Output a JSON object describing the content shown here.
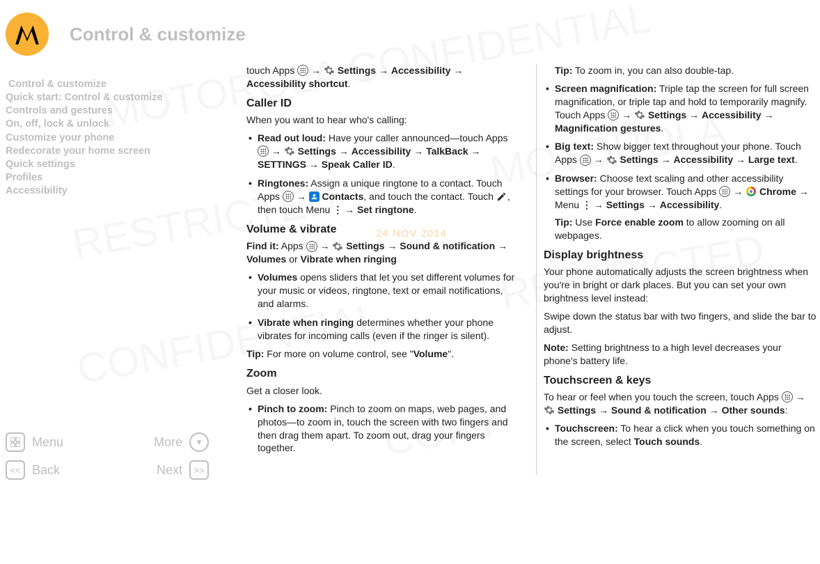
{
  "header": {
    "title": "Control & customize"
  },
  "watermark_date": "24 NOV 2014",
  "sidebar": {
    "items": [
      "Control & customize",
      "Quick start: Control & customize",
      "Controls and gestures",
      "On, off, lock & unlock",
      "Customize your phone",
      "Redecorate your home screen",
      "Quick settings",
      "Profiles",
      "Accessibility"
    ]
  },
  "bottomnav": {
    "menu": "Menu",
    "more": "More",
    "back": "Back",
    "next": "Next"
  },
  "col1": {
    "p1a": "touch Apps ",
    "p1b": " Settings",
    "p1c": "Accessibility",
    "p1d": "Accessibility shortcut",
    "h_callerid": "Caller ID",
    "callerid_lead": "When you want to hear who's calling:",
    "read_label": "Read out loud:",
    "read_text": " Have your caller announced—touch Apps ",
    "read_settings": " Settings",
    "read_acc": "Accessibility",
    "read_tb": "TalkBack",
    "read_set": "SETTINGS",
    "read_speak": "Speak Caller ID",
    "ring_label": "Ringtones:",
    "ring_text1": " Assign a unique ringtone to a contact. Touch Apps ",
    "ring_contacts": " Contacts",
    "ring_text2": ", and touch the contact. Touch ",
    "ring_text3": ", then touch Menu ",
    "ring_set": "Set ringtone",
    "h_volume": "Volume & vibrate",
    "findit": "Find it:",
    "vol_path1": " Apps ",
    "vol_settings": " Settings",
    "vol_sound": "Sound & notification",
    "vol_volumes": "Volumes",
    "vol_or": " or ",
    "vol_vibrate": "Vibrate when ringing",
    "vol_li1a": "Volumes",
    "vol_li1b": " opens sliders that let you set different volumes for your music or videos, ringtone, text or email notifications, and alarms.",
    "vol_li2a": "Vibrate when ringing",
    "vol_li2b": " determines whether your phone vibrates for incoming calls (even if the ringer is silent).",
    "vol_tip_label": "Tip:",
    "vol_tip": " For more on volume control, see \"",
    "vol_tip_link": "Volume",
    "vol_tip_end": "\".",
    "h_zoom": "Zoom",
    "zoom_lead": "Get a closer look.",
    "pinch_label": "Pinch to zoom:",
    "pinch_text": " Pinch to zoom on maps, web pages, and photos—to zoom in, touch the screen with two fingers and then drag them apart. To zoom out, drag your fingers together."
  },
  "col2": {
    "tip1_label": "Tip:",
    "tip1": " To zoom in, you can also double-tap.",
    "mag_label": "Screen magnification:",
    "mag_text": " Triple tap the screen for full screen magnification, or triple tap and hold to temporarily magnify. Touch Apps ",
    "mag_settings": " Settings",
    "mag_acc": "Accessibility",
    "mag_gest": "Magnification gestures",
    "big_label": "Big text:",
    "big_text": " Show bigger text throughout your phone. Touch Apps ",
    "big_settings": " Settings",
    "big_acc": "Accessibility",
    "big_large": "Large text",
    "browser_label": "Browser:",
    "browser_text": " Choose text scaling and other accessibility settings for your browser. Touch Apps ",
    "browser_chrome": " Chrome",
    "browser_menu": "Menu ",
    "browser_settings": "Settings",
    "browser_acc": "Accessibility",
    "browser_tip_label": "Tip:",
    "browser_tip1": " Use ",
    "browser_tip_force": "Force enable zoom",
    "browser_tip2": " to allow zooming on all webpages.",
    "h_display": "Display brightness",
    "display_p1": "Your phone automatically adjusts the screen brightness when you're in bright or dark places. But you can set your own brightness level instead:",
    "display_p2": "Swipe down the status bar with two fingers, and slide the bar to adjust.",
    "display_note_label": "Note:",
    "display_note": " Setting brightness to a high level decreases your phone's battery life.",
    "h_touch": "Touchscreen & keys",
    "touch_lead1": "To hear or feel when you touch the screen, touch Apps ",
    "touch_settings": " Settings",
    "touch_sound": "Sound & notification",
    "touch_other": "Other sounds",
    "touch_li_label": "Touchscreen:",
    "touch_li_text": " To hear a click when you touch something on the screen, select ",
    "touch_li_sounds": "Touch sounds"
  }
}
